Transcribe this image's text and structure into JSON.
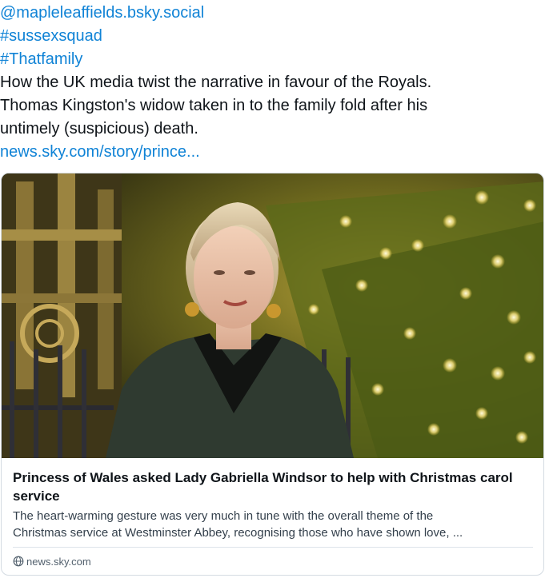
{
  "post": {
    "mention": "@mapleleaffields.bsky.social",
    "hashtags": [
      "#sussexsquad",
      "#Thatfamily"
    ],
    "body_lines": [
      "How the UK media twist the narrative in favour of the Royals.",
      "Thomas Kingston's widow taken in to the family fold after his",
      "untimely (suspicious) death."
    ],
    "link_text": "news.sky.com/story/prince..."
  },
  "card": {
    "title": "Princess of Wales asked Lady Gabriella Windsor to help with Christmas carol service",
    "description_lines": [
      "The heart-warming gesture was very much in tune with the overall theme of the",
      "Christmas service at Westminster Abbey, recognising those who have shown love, ..."
    ],
    "domain": "news.sky.com",
    "domain_icon": "globe-icon"
  },
  "colors": {
    "link": "#1083d6",
    "text": "#0f1419",
    "muted": "#52606d",
    "border": "#d4dbe2"
  }
}
